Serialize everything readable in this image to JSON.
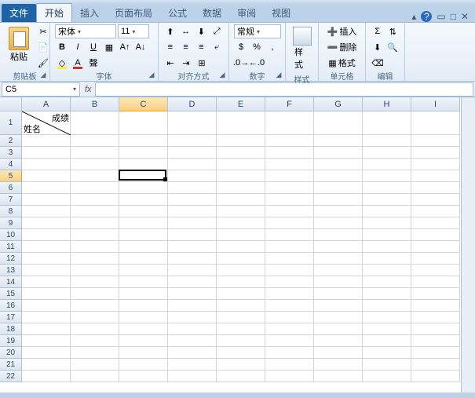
{
  "tabs": {
    "file": "文件",
    "items": [
      "开始",
      "插入",
      "页面布局",
      "公式",
      "数据",
      "审阅",
      "视图"
    ],
    "active_index": 0
  },
  "ribbon": {
    "clipboard": {
      "paste": "粘贴",
      "label": "剪贴板"
    },
    "font": {
      "name": "宋体",
      "size": "11",
      "label": "字体",
      "bold": "B",
      "italic": "I",
      "underline": "U"
    },
    "alignment": {
      "label": "对齐方式"
    },
    "number": {
      "format": "常规",
      "label": "数字"
    },
    "styles": {
      "label": "样式",
      "btn": "样式"
    },
    "cells": {
      "insert": "插入",
      "delete": "删除",
      "format": "格式",
      "label": "单元格"
    },
    "editing": {
      "label": "编辑"
    }
  },
  "namebox": "C5",
  "formula": "",
  "columns": [
    "A",
    "B",
    "C",
    "D",
    "E",
    "F",
    "G",
    "H",
    "I"
  ],
  "rows": [
    1,
    2,
    3,
    4,
    5,
    6,
    7,
    8,
    9,
    10,
    11,
    12,
    13,
    14,
    15,
    16,
    17,
    18,
    19,
    20,
    21,
    22
  ],
  "cell_a1": {
    "top": "成绩",
    "bottom": "姓名"
  },
  "selected": {
    "col": "C",
    "row": 5
  },
  "colors": {
    "accent": "#1e63a8",
    "grid": "#d4d4d4",
    "header": "#dce6f1"
  }
}
